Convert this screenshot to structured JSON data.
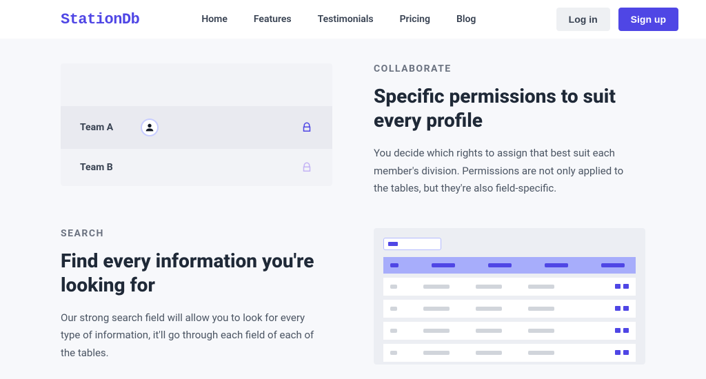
{
  "brand": "StationDb",
  "nav": {
    "home": "Home",
    "features": "Features",
    "testimonials": "Testimonials",
    "pricing": "Pricing",
    "blog": "Blog"
  },
  "auth": {
    "login": "Log in",
    "signup": "Sign up"
  },
  "collaborate": {
    "kicker": "COLLABORATE",
    "title": "Specific permissions to suit every profile",
    "body": "You decide which rights to assign that best suit each member's division. Permissions are not only applied to the tables, but they're also field-specific.",
    "teams": {
      "a": "Team A",
      "b": "Team B"
    }
  },
  "search": {
    "kicker": "SEARCH",
    "title": "Find every information you're looking for",
    "body": "Our strong search field will allow you to look for every type of information, it'll go through each field of each of the tables."
  }
}
